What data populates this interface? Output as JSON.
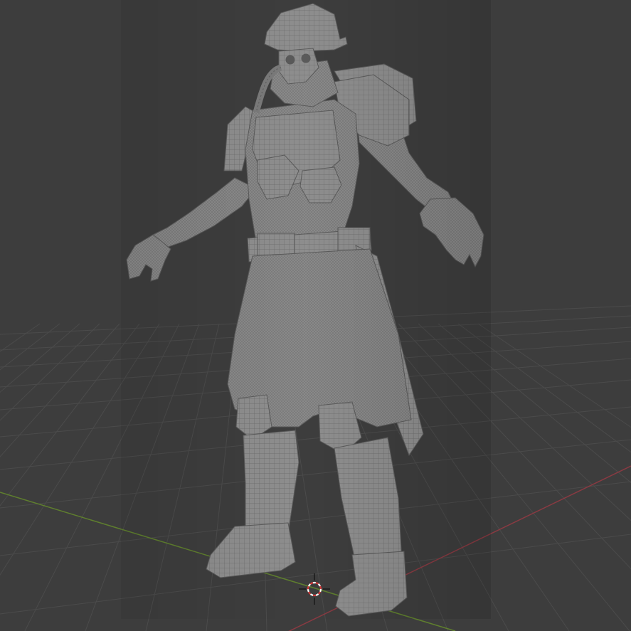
{
  "viewport": {
    "mode": "3d-viewport",
    "background_color": "#3d3d3d",
    "grid_color": "#4b4b4b",
    "x_axis_color": "#8a3a42",
    "y_axis_color": "#5f7f2e",
    "grid_visible": true
  },
  "model": {
    "description_icon": "mesh-character-wireframe",
    "surface_color": "#8c8c8c",
    "wire_color": "#6e6e6e"
  },
  "cursor": {
    "icon": "3d-cursor-icon",
    "ring_color_a": "#ffffff",
    "ring_color_b": "#d33a3a"
  }
}
